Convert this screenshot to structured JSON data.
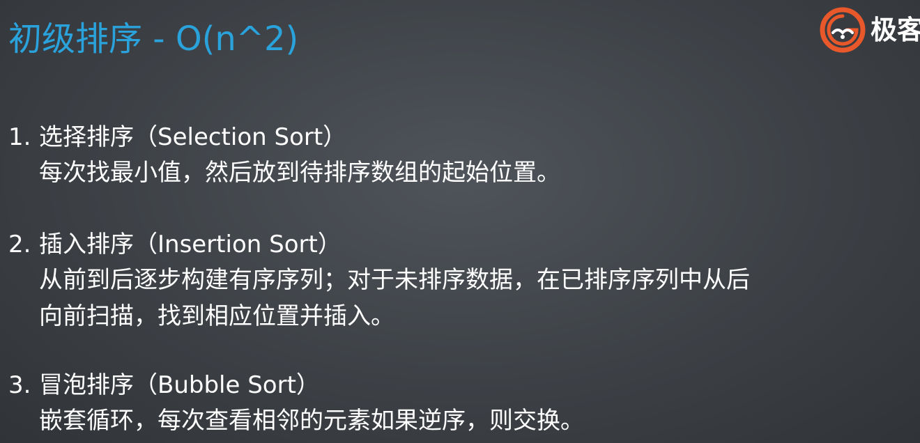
{
  "slide": {
    "title": "初级排序 - O(n^2)",
    "logo": {
      "icon": "geek-logo-icon",
      "text": "极客",
      "color": "#e8582a"
    },
    "items": [
      {
        "number": "1.",
        "heading": "选择排序（Selection Sort）",
        "lines": [
          "每次找最小值，然后放到待排序数组的起始位置。"
        ]
      },
      {
        "number": "2.",
        "heading": "插入排序（Insertion Sort）",
        "lines": [
          "从前到后逐步构建有序序列；对于未排序数据，在已排序序列中从后",
          "向前扫描，找到相应位置并插入。"
        ]
      },
      {
        "number": "3.",
        "heading": "冒泡排序（Bubble Sort）",
        "lines": [
          "嵌套循环，每次查看相邻的元素如果逆序，则交换。"
        ]
      }
    ],
    "colors": {
      "title": "#2aa3dc",
      "text": "#ffffff",
      "background": "#3d4146"
    }
  }
}
